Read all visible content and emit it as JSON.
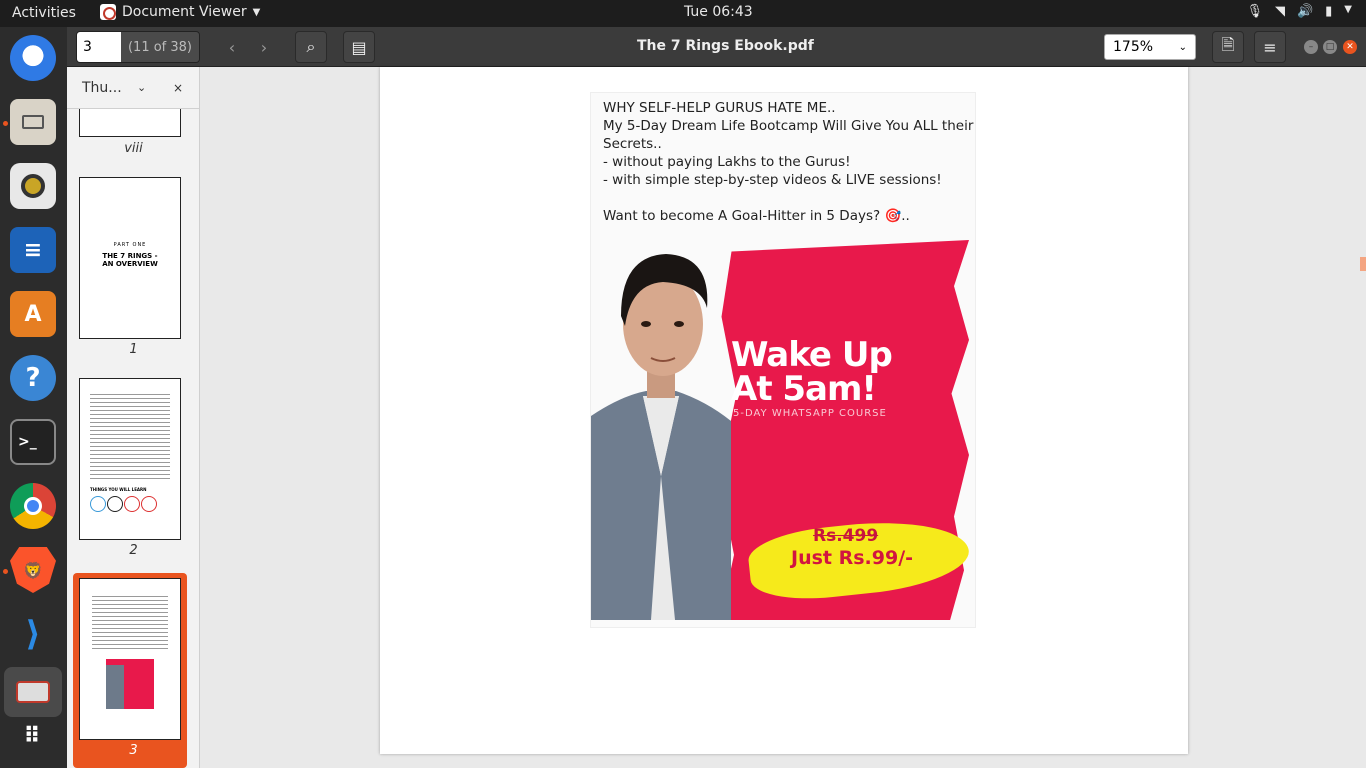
{
  "topbar": {
    "activities": "Activities",
    "app_name": "Document Viewer",
    "clock": "Tue 06:43"
  },
  "headerbar": {
    "page_value": "3",
    "page_total": "(11 of 38)",
    "title": "The 7 Rings Ebook.pdf",
    "zoom": "175%"
  },
  "sidebar": {
    "mode_label": "Thu...",
    "thumbnails": [
      {
        "label": "viii"
      },
      {
        "label": "1",
        "text_line1": "PART ONE",
        "text_line2": "THE 7 RINGS -",
        "text_line3": "AN OVERVIEW"
      },
      {
        "label": "2",
        "heading": "THINGS YOU WILL LEARN"
      },
      {
        "label": "3",
        "selected": true
      }
    ]
  },
  "document": {
    "lines": [
      "WHY SELF-HELP GURUS HATE ME..",
      "My 5-Day Dream Life Bootcamp Will Give You ALL their",
      "Secrets..",
      "- without paying Lakhs to the Gurus!",
      "- with simple step-by-step videos & LIVE sessions!",
      "",
      "Want to become A Goal-Hitter in 5 Days? 🎯.."
    ],
    "banner": {
      "headline1": "Wake Up",
      "headline2": "At 5am!",
      "subtitle": "5-DAY WHATSAPP COURSE",
      "old_price": "Rs.499",
      "new_price": "Just Rs.99/-"
    }
  },
  "colors": {
    "accent": "#e9541f",
    "banner_red": "#e8194b",
    "banner_yellow": "#f6ea1b"
  }
}
